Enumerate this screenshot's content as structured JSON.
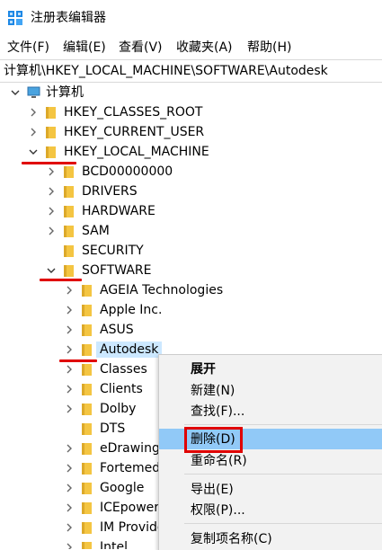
{
  "window": {
    "title": "注册表编辑器",
    "icon": "registry-editor-icon"
  },
  "menu": [
    "文件(F)",
    "编辑(E)",
    "查看(V)",
    "收藏夹(A)",
    "帮助(H)"
  ],
  "address": "计算机\\HKEY_LOCAL_MACHINE\\SOFTWARE\\Autodesk",
  "tree": {
    "root": "计算机",
    "hkcr": "HKEY_CLASSES_ROOT",
    "hkcu": "HKEY_CURRENT_USER",
    "hklm": "HKEY_LOCAL_MACHINE",
    "hklm_children": {
      "bcd": "BCD00000000",
      "drivers": "DRIVERS",
      "hardware": "HARDWARE",
      "sam": "SAM",
      "security": "SECURITY",
      "software": "SOFTWARE"
    },
    "software_children": [
      "AGEIA Technologies",
      "Apple Inc.",
      "ASUS",
      "Autodesk",
      "Classes",
      "Clients",
      "Dolby",
      "DTS",
      "eDrawings",
      "Fortemedia",
      "Google",
      "ICEpower",
      "IM Providers",
      "Intel"
    ],
    "selected": "Autodesk"
  },
  "context_menu": {
    "items": [
      "展开",
      "新建(N)",
      "查找(F)...",
      "删除(D)",
      "重命名(R)",
      "导出(E)",
      "权限(P)...",
      "复制项名称(C)"
    ],
    "default_item": "展开",
    "hover_item": "删除(D)"
  },
  "colors": {
    "folder": "#f4c542",
    "selection": "#cce8ff",
    "menu_hover": "#91c9f7",
    "annotation_red": "#e00000"
  }
}
